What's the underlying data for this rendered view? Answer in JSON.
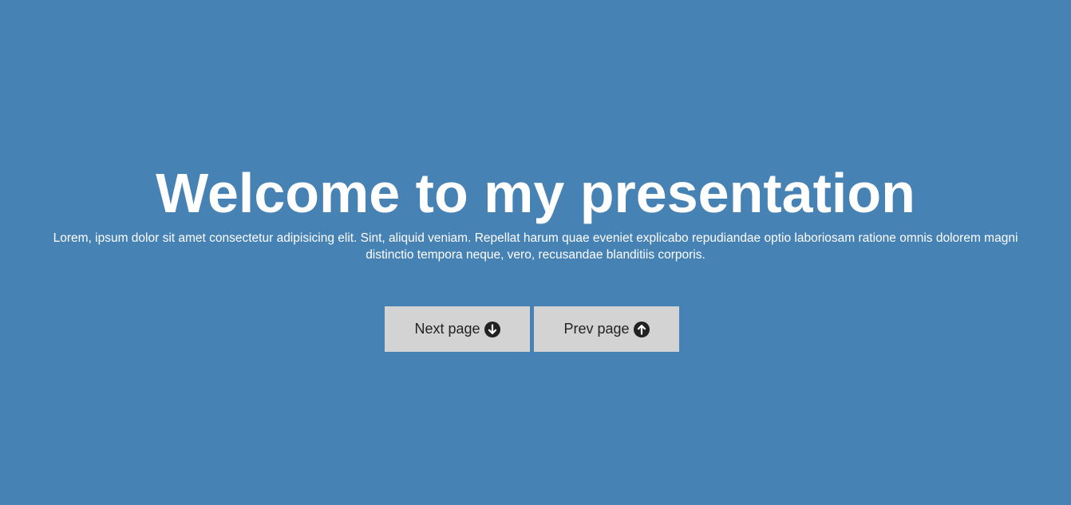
{
  "hero": {
    "title": "Welcome to my presentation",
    "description": "Lorem, ipsum dolor sit amet consectetur adipisicing elit. Sint, aliquid veniam. Repellat harum quae eveniet explicabo repudiandae optio laboriosam ratione omnis dolorem magni distinctio tempora neque, vero, recusandae blanditiis corporis."
  },
  "buttons": {
    "next": {
      "label": "Next page",
      "icon": "arrow-down-circle-icon"
    },
    "prev": {
      "label": "Prev page",
      "icon": "arrow-up-circle-icon"
    }
  },
  "colors": {
    "background": "#4682b4",
    "button_bg": "#d3d3d3",
    "text": "#ffffff",
    "button_text": "#222222"
  }
}
